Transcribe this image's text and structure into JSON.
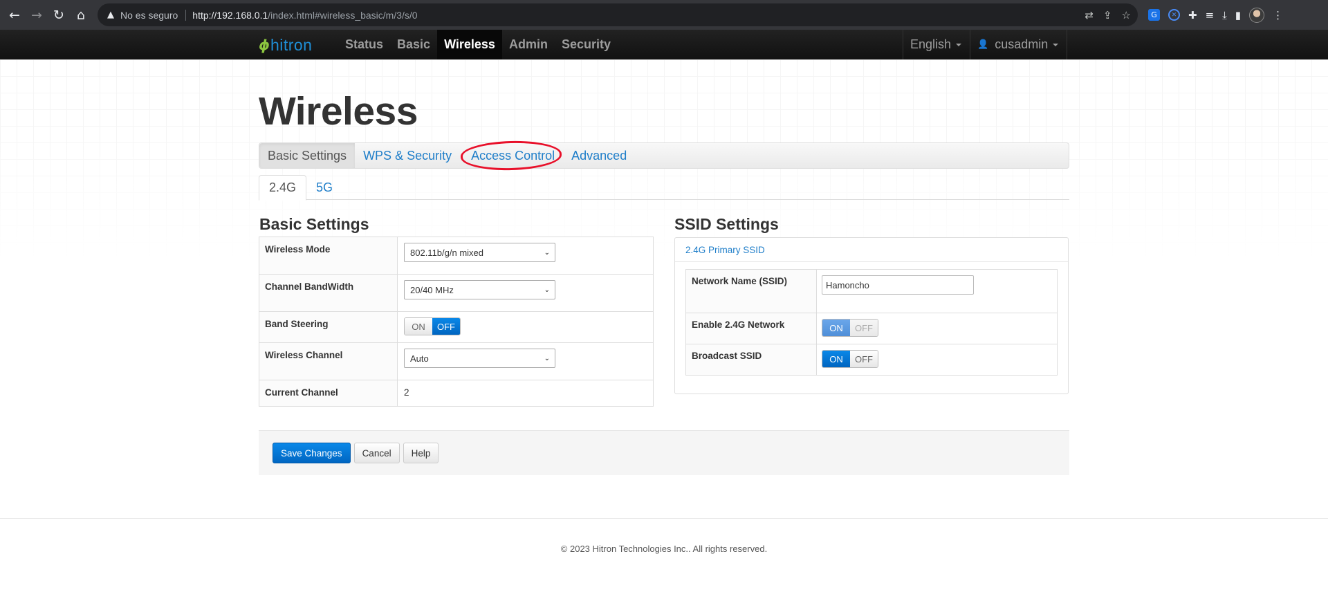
{
  "browser": {
    "security_label": "No es seguro",
    "url_host": "http://192.168.0.1",
    "url_path": "/index.html#wireless_basic/m/3/s/0"
  },
  "nav": {
    "logo_text": "hitron",
    "menu": [
      {
        "label": "Status",
        "active": false
      },
      {
        "label": "Basic",
        "active": false
      },
      {
        "label": "Wireless",
        "active": true
      },
      {
        "label": "Admin",
        "active": false
      },
      {
        "label": "Security",
        "active": false
      }
    ],
    "language": "English",
    "user": "cusadmin"
  },
  "page": {
    "title": "Wireless",
    "tabs": [
      "Basic Settings",
      "WPS & Security",
      "Access Control",
      "Advanced"
    ],
    "active_tab": "Basic Settings",
    "highlighted_tab": "Access Control",
    "annotation_color": "#e8102a",
    "band_tabs": [
      "2.4G",
      "5G"
    ],
    "active_band": "2.4G"
  },
  "basic_settings": {
    "title": "Basic Settings",
    "wireless_mode": {
      "label": "Wireless Mode",
      "value": "802.11b/g/n mixed"
    },
    "channel_bandwidth": {
      "label": "Channel BandWidth",
      "value": "20/40 MHz"
    },
    "band_steering": {
      "label": "Band Steering",
      "on": "ON",
      "off": "OFF",
      "state": "OFF"
    },
    "wireless_channel": {
      "label": "Wireless Channel",
      "value": "Auto"
    },
    "current_channel": {
      "label": "Current Channel",
      "value": "2"
    }
  },
  "ssid_settings": {
    "title": "SSID Settings",
    "panel_heading": "2.4G Primary SSID",
    "network_name": {
      "label": "Network Name (SSID)",
      "value": "Hamoncho"
    },
    "enable_network": {
      "label": "Enable 2.4G Network",
      "on": "ON",
      "off": "OFF",
      "state": "ON",
      "disabled": true
    },
    "broadcast_ssid": {
      "label": "Broadcast SSID",
      "on": "ON",
      "off": "OFF",
      "state": "ON"
    }
  },
  "actions": {
    "save": "Save Changes",
    "cancel": "Cancel",
    "help": "Help"
  },
  "footer": {
    "copyright": "© 2023 Hitron Technologies Inc.. All rights reserved."
  },
  "colors": {
    "accent": "#1f7ec9",
    "primary_button": "#0a7ad6",
    "nav_bg": "#1a1a1a"
  }
}
